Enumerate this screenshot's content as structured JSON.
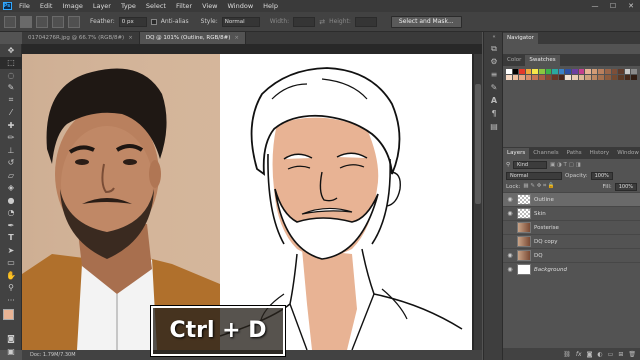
{
  "menubar": {
    "app_logo": "Ps",
    "items": [
      "File",
      "Edit",
      "Image",
      "Layer",
      "Type",
      "Select",
      "Filter",
      "View",
      "Window",
      "Help"
    ],
    "window_controls": [
      "—",
      "☐",
      "✕"
    ]
  },
  "options": {
    "feather_label": "Feather:",
    "feather_value": "0 px",
    "antialias_label": "Anti-alias",
    "style_label": "Style:",
    "style_value": "Normal",
    "width_label": "Width:",
    "height_label": "Height:",
    "select_mask_label": "Select and Mask..."
  },
  "tabs": [
    {
      "label": "01704276R.jpg @ 66.7% (RGB/8#)",
      "close": "×",
      "active": false
    },
    {
      "label": "DQ @ 101% (Outline, RGB/8#)",
      "close": "×",
      "active": true
    }
  ],
  "status": {
    "text": "Doc: 1.79M/7.30M"
  },
  "overlay": {
    "shortcut": "Ctrl + D"
  },
  "navigator": {
    "tab": "Navigator"
  },
  "color_panel": {
    "tabs": [
      "Color",
      "Swatches"
    ],
    "active": "Swatches"
  },
  "layers_panel": {
    "tabs": [
      "Layers",
      "Channels",
      "Paths",
      "History",
      "Window"
    ],
    "kind_label": "Kind",
    "blend_mode": "Normal",
    "opacity_label": "Opacity:",
    "opacity_value": "100%",
    "lock_label": "Lock:",
    "fill_label": "Fill:",
    "fill_value": "100%",
    "layers": [
      {
        "name": "Outline",
        "selected": true,
        "visible": true,
        "thumb": "checker",
        "italic": false
      },
      {
        "name": "Skin",
        "selected": false,
        "visible": true,
        "thumb": "checker",
        "italic": false
      },
      {
        "name": "Posterise",
        "selected": false,
        "visible": false,
        "thumb": "photo",
        "italic": false
      },
      {
        "name": "DQ copy",
        "selected": false,
        "visible": false,
        "thumb": "photo",
        "italic": false
      },
      {
        "name": "DQ",
        "selected": false,
        "visible": true,
        "thumb": "photo",
        "italic": false
      },
      {
        "name": "Background",
        "selected": false,
        "visible": true,
        "thumb": "white",
        "italic": true
      }
    ],
    "footer_icons": [
      "link-icon",
      "fx-icon",
      "mask-icon",
      "adjustment-icon",
      "folder-icon",
      "new-layer-icon",
      "trash-icon"
    ]
  },
  "colors": {
    "ui_dark": "#3a3a3a",
    "skin": "#e8b394",
    "photo_bg": "#d2b398",
    "jacket": "#b0702c",
    "accent": "#31a8ff"
  }
}
